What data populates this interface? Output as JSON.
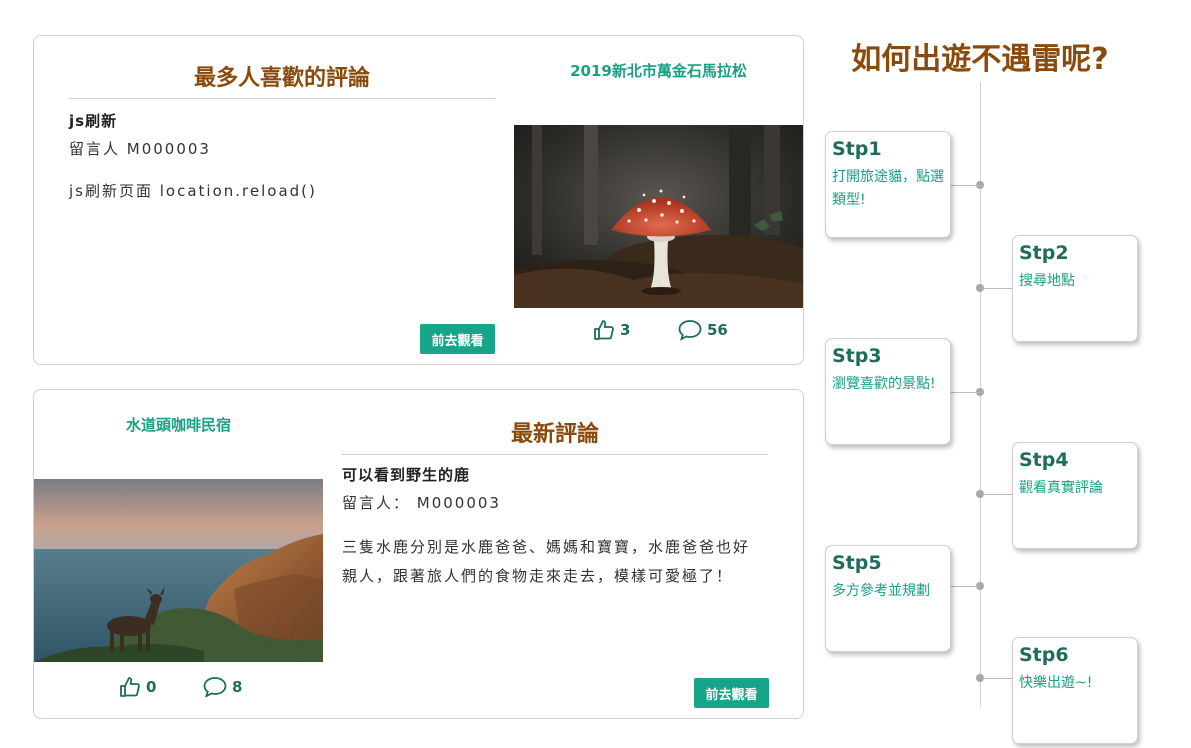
{
  "card1": {
    "section_title": "最多人喜歡的評論",
    "place": "2019新北市萬金石馬拉松",
    "comment_title": "js刷新",
    "author": "留言人 M000003",
    "body": "js刷新页面 location.reload()",
    "button_label": "前去觀看",
    "likes": "3",
    "comments": "56"
  },
  "card2": {
    "section_title": "最新評論",
    "place": "水道頭咖啡民宿",
    "comment_title": "可以看到野生的鹿",
    "author": "留言人： M000003",
    "body": "三隻水鹿分別是水鹿爸爸、媽媽和寶寶，水鹿爸爸也好親人，跟著旅人們的食物走來走去，模樣可愛極了！",
    "button_label": "前去觀看",
    "likes": "0",
    "comments": "8"
  },
  "timeline": {
    "title": "如何出遊不遇雷呢?",
    "steps": [
      {
        "name": "Stp1",
        "desc": "打開旅途貓，點選類型!"
      },
      {
        "name": "Stp2",
        "desc": "搜尋地點"
      },
      {
        "name": "Stp3",
        "desc": "瀏覽喜歡的景點!"
      },
      {
        "name": "Stp4",
        "desc": "觀看真實評論"
      },
      {
        "name": "Stp5",
        "desc": "多方參考並規劃"
      },
      {
        "name": "Stp6",
        "desc": "快樂出遊~!"
      }
    ]
  },
  "colors": {
    "accent": "#17a589",
    "title_brown": "#8a4a0b",
    "icon_green": "#1f6b5c"
  },
  "icons": {
    "like": "thumbs-up-icon",
    "comment": "comment-bubble-icon"
  }
}
